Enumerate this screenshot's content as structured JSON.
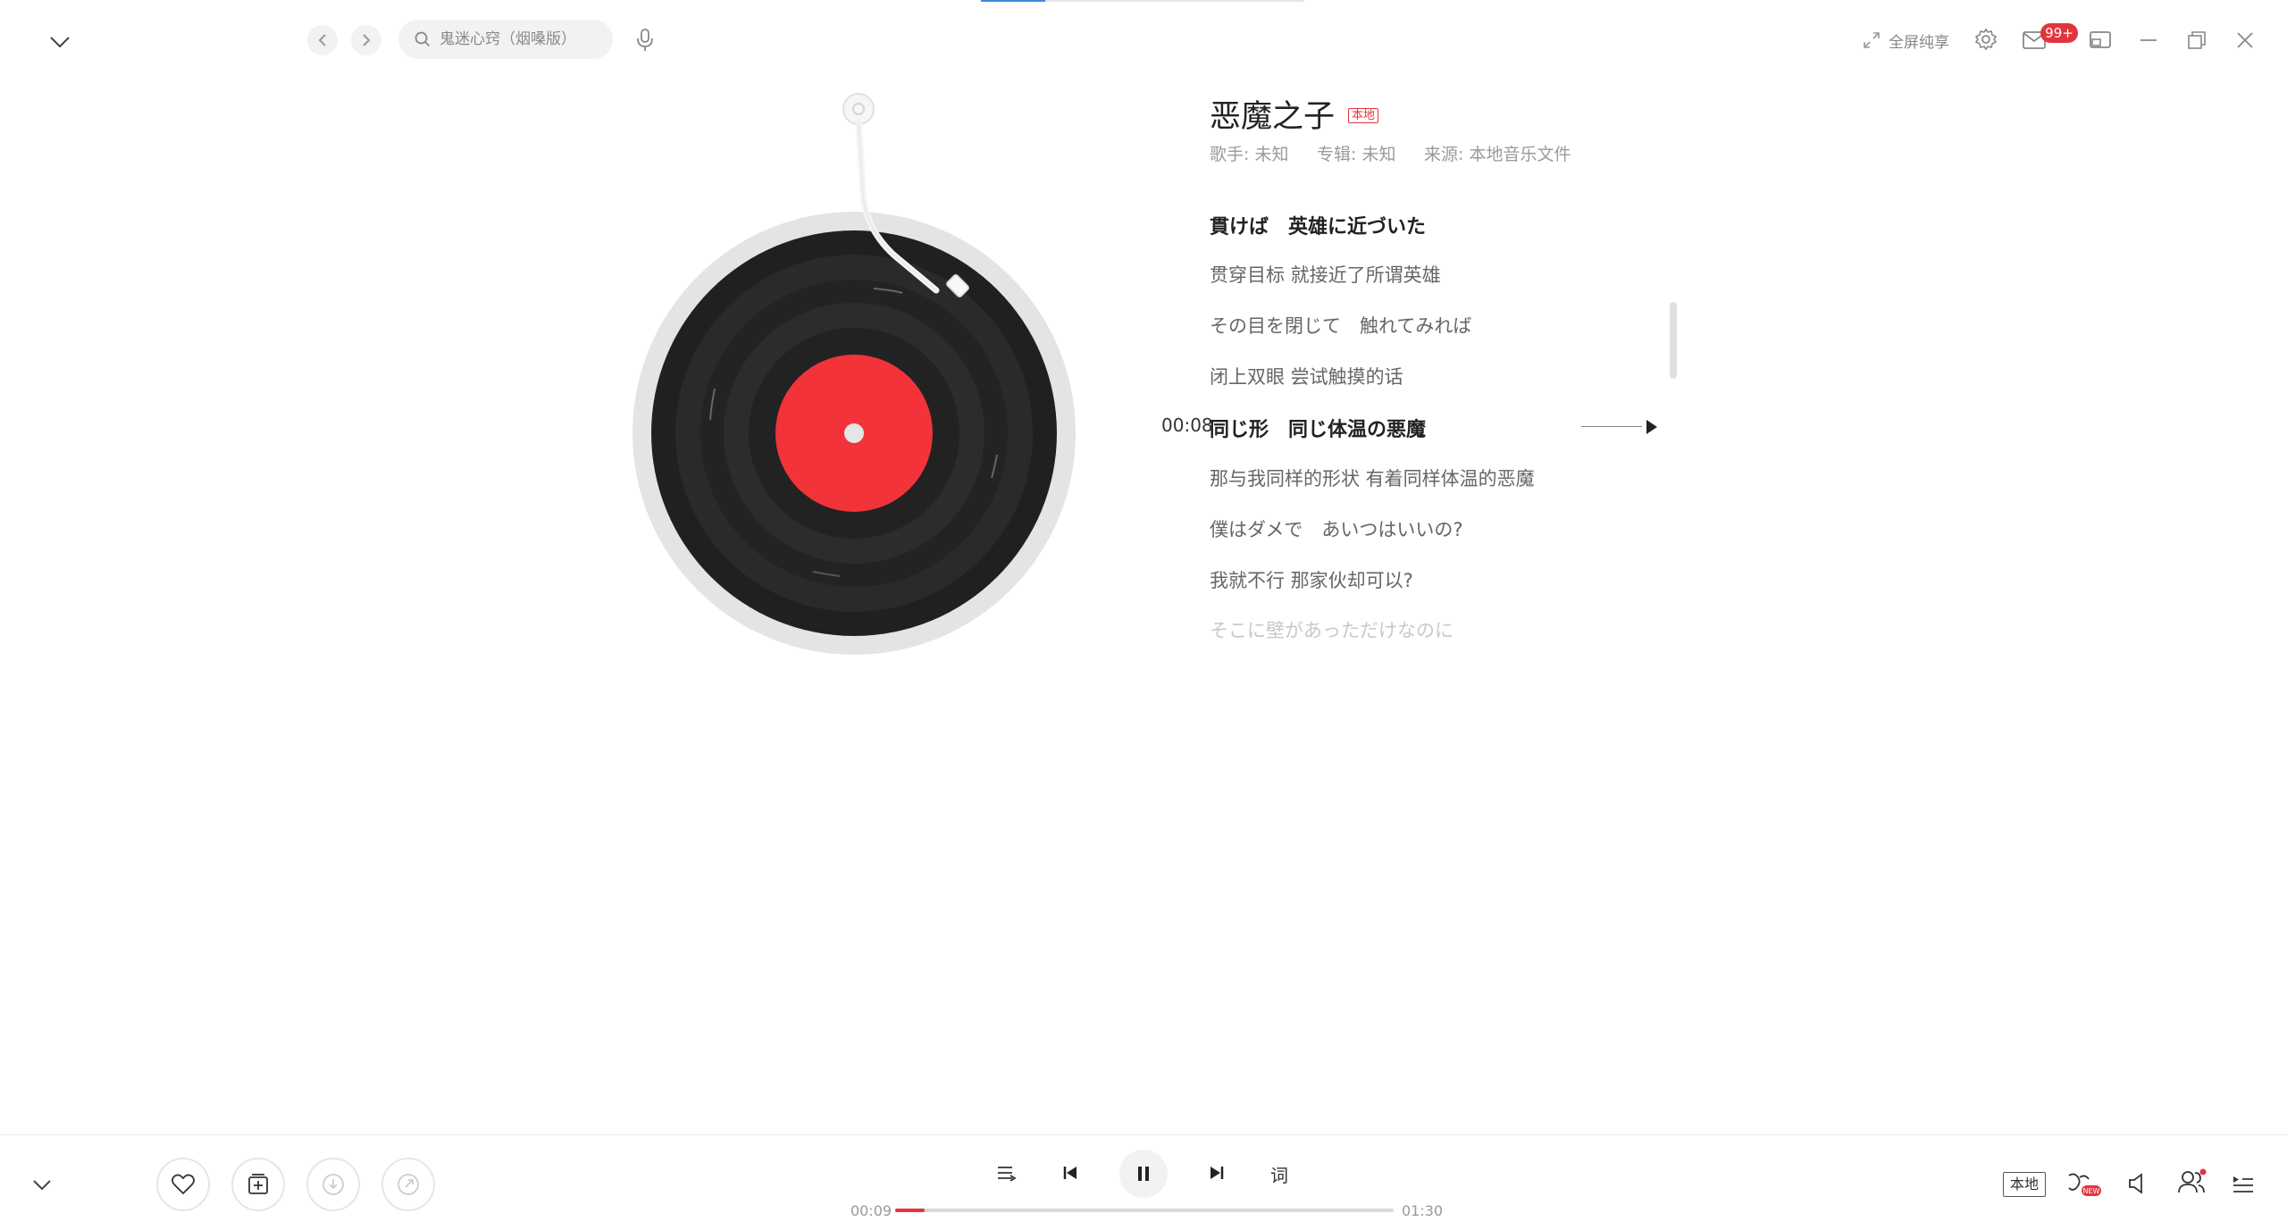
{
  "header": {
    "search": {
      "placeholder": "鬼迷心窍（烟嗓版）"
    },
    "fullscreen_label": "全屏纯享",
    "mail_badge": "99+"
  },
  "song": {
    "title": "恶魔之子",
    "tag": "本地",
    "singer": "歌手: 未知",
    "album": "专辑: 未知",
    "source": "来源: 本地音乐文件"
  },
  "lyrics": {
    "current_time": "00:08",
    "lines": [
      "貫けば　英雄に近づいた",
      "贯穿目标 就接近了所谓英雄",
      "その目を閉じて　触れてみれば",
      "闭上双眼 尝试触摸的话",
      "同じ形　同じ体温の悪魔",
      "那与我同样的形状 有着同样体温的恶魔",
      "僕はダメで　あいつはいいの?",
      "我就不行 那家伙却可以?",
      "そこに壁があっただけなのに"
    ]
  },
  "player": {
    "elapsed": "00:09",
    "duration": "01:30",
    "progress_fraction": 0.06,
    "lyric_toggle": "词",
    "local_label": "本地",
    "accent_color": "#e3343c"
  }
}
